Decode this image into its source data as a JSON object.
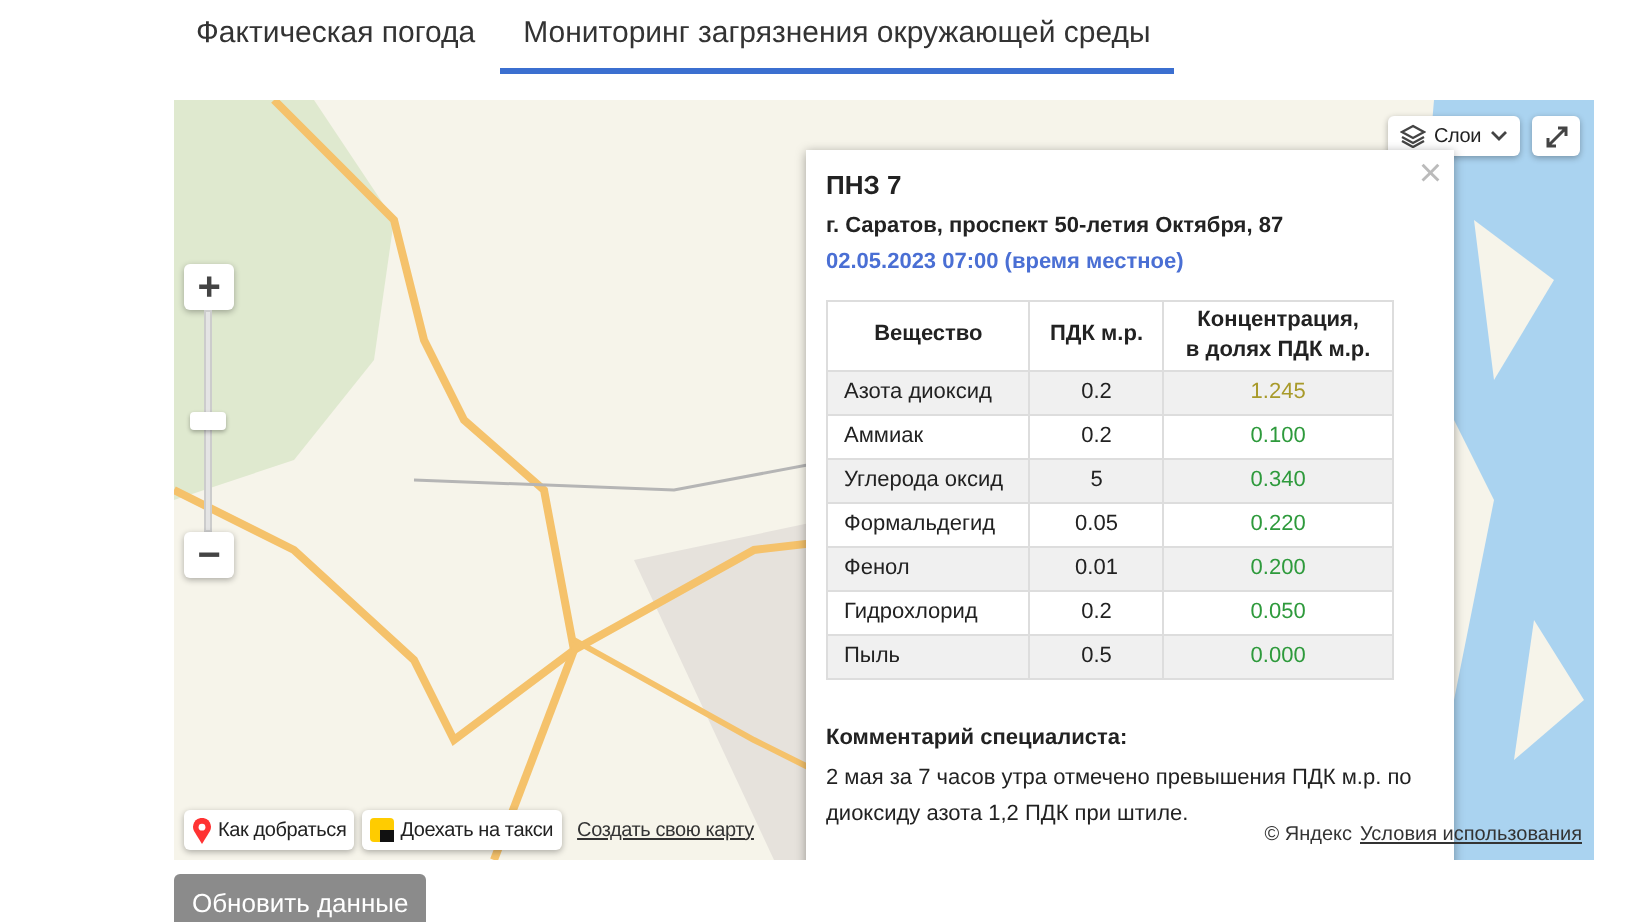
{
  "tabs": [
    {
      "label": "Фактическая погода",
      "selected": false
    },
    {
      "label": "Мониторинг загрязнения окружающей среды",
      "selected": true
    }
  ],
  "map": {
    "kind": "picture",
    "zoom": {
      "level": 0.5
    },
    "layers_button": "Слои",
    "zoom_in": "+",
    "zoom_out": "−",
    "route_button": "Как добраться",
    "taxi_button": "Доехать на такси",
    "create_map_link": "Создать свою карту",
    "copyright": "© Яндекс",
    "terms_link": "Условия использования"
  },
  "popup": {
    "title": "ПНЗ 7",
    "address": "г. Саратов, проспект 50-летия Октября, 87",
    "datetime": "02.05.2023 07:00 (время местное)",
    "close": "×",
    "columns": [
      "Вещество",
      "ПДК м.р.",
      "Концентрация,\nв долях ПДК м.р."
    ],
    "rows": [
      {
        "substance": "Азота диоксид",
        "pdk": "0.2",
        "concentration": "1.245",
        "color": "#a89a2a"
      },
      {
        "substance": "Аммиак",
        "pdk": "0.2",
        "concentration": "0.100",
        "color": "#2e9a3c"
      },
      {
        "substance": "Углерода оксид",
        "pdk": "5",
        "concentration": "0.340",
        "color": "#2e9a3c"
      },
      {
        "substance": "Формальдегид",
        "pdk": "0.05",
        "concentration": "0.220",
        "color": "#2e9a3c"
      },
      {
        "substance": "Фенол",
        "pdk": "0.01",
        "concentration": "0.200",
        "color": "#2e9a3c"
      },
      {
        "substance": "Гидрохлорид",
        "pdk": "0.2",
        "concentration": "0.050",
        "color": "#2e9a3c"
      },
      {
        "substance": "Пыль",
        "pdk": "0.5",
        "concentration": "0.000",
        "color": "#2e9a3c"
      }
    ],
    "comment_title": "Комментарий специалиста:",
    "comment": "2 мая за 7 часов утра отмечено превышения ПДК м.р. по диоксиду азота 1,2 ПДК при штиле."
  },
  "refresh_button": "Обновить данные"
}
